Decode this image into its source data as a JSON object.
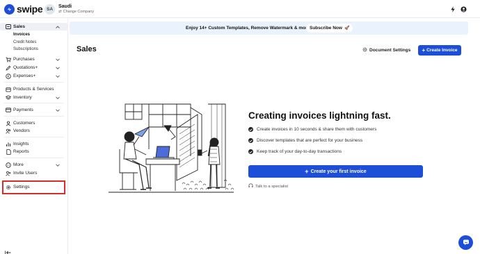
{
  "app": {
    "logo_text": "swipe"
  },
  "header": {
    "avatar_initials": "SA",
    "company_name": "Saudi",
    "change_company_label": "Change Company",
    "icons": [
      "bolt-icon",
      "user-circle-icon"
    ]
  },
  "sidebar": {
    "sales": {
      "label": "Sales",
      "sub_items": [
        "Invoices",
        "Credit Notes",
        "Subscriptions"
      ]
    },
    "purchases": "Purchases",
    "quotations": "Quotations+",
    "expenses": "Expenses+",
    "products_services": "Products & Services",
    "inventory": "Inventory",
    "payments": "Payments",
    "customers": "Customers",
    "vendors": "Vendors",
    "insights": "Insights",
    "reports": "Reports",
    "more": "More",
    "invite_users": "Invite Users",
    "settings": "Settings"
  },
  "banner": {
    "text": "Enjoy 14+ Custom Templates, Remove Watermark & more",
    "button_label": "Subscribe Now",
    "button_emoji": "🚀"
  },
  "main": {
    "title": "Sales",
    "document_settings_label": "Document Settings",
    "create_invoice_label": "Create Invoice",
    "hero_title": "Creating invoices lightning fast.",
    "features": [
      "Create invoices in 10 seconds & share them with customers",
      "Discover templates that are perfect for your business",
      "Keep track of your day-to-day transactions"
    ],
    "create_first_label": "Create your first invoice",
    "talk_label": "Talk to a specialist"
  },
  "colors": {
    "accent": "#1d4ed8",
    "banner_bg": "#e9f2fd",
    "highlight_box": "#d32f2f"
  }
}
